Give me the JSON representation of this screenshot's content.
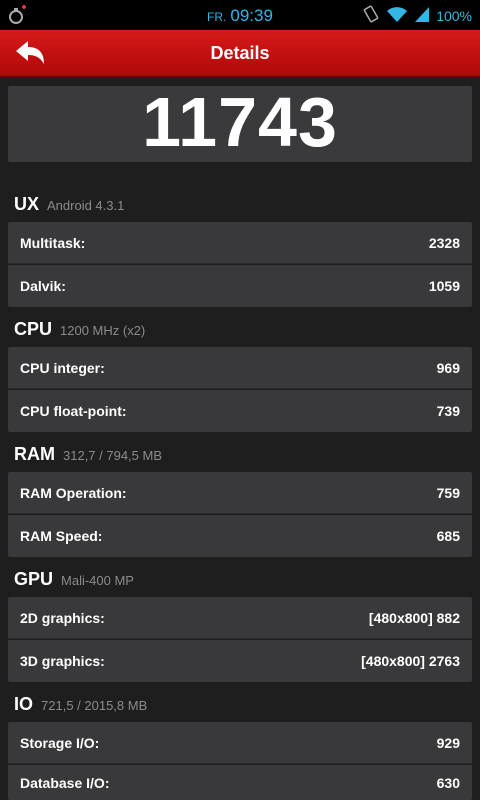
{
  "status": {
    "day": "FR.",
    "time": "09:39",
    "battery": "100%"
  },
  "header": {
    "title": "Details"
  },
  "score": "11743",
  "sections": [
    {
      "name": "UX",
      "info": "Android 4.3.1",
      "rows": [
        {
          "label": "Multitask:",
          "value": "2328"
        },
        {
          "label": "Dalvik:",
          "value": "1059"
        }
      ]
    },
    {
      "name": "CPU",
      "info": "1200 MHz (x2)",
      "rows": [
        {
          "label": "CPU integer:",
          "value": "969"
        },
        {
          "label": "CPU float-point:",
          "value": "739"
        }
      ]
    },
    {
      "name": "RAM",
      "info": "312,7 / 794,5 MB",
      "rows": [
        {
          "label": "RAM Operation:",
          "value": "759"
        },
        {
          "label": "RAM Speed:",
          "value": "685"
        }
      ]
    },
    {
      "name": "GPU",
      "info": "Mali-400 MP",
      "rows": [
        {
          "label": "2D graphics:",
          "value": "[480x800] 882"
        },
        {
          "label": "3D graphics:",
          "value": "[480x800] 2763"
        }
      ]
    },
    {
      "name": "IO",
      "info": "721,5 / 2015,8 MB",
      "rows": [
        {
          "label": "Storage I/O:",
          "value": "929"
        },
        {
          "label": "Database I/O:",
          "value": "630"
        }
      ]
    }
  ],
  "colors": {
    "accent_red": "#c41010",
    "status_blue": "#33b5e5",
    "background": "#1e1e1e",
    "card": "#39393b"
  }
}
